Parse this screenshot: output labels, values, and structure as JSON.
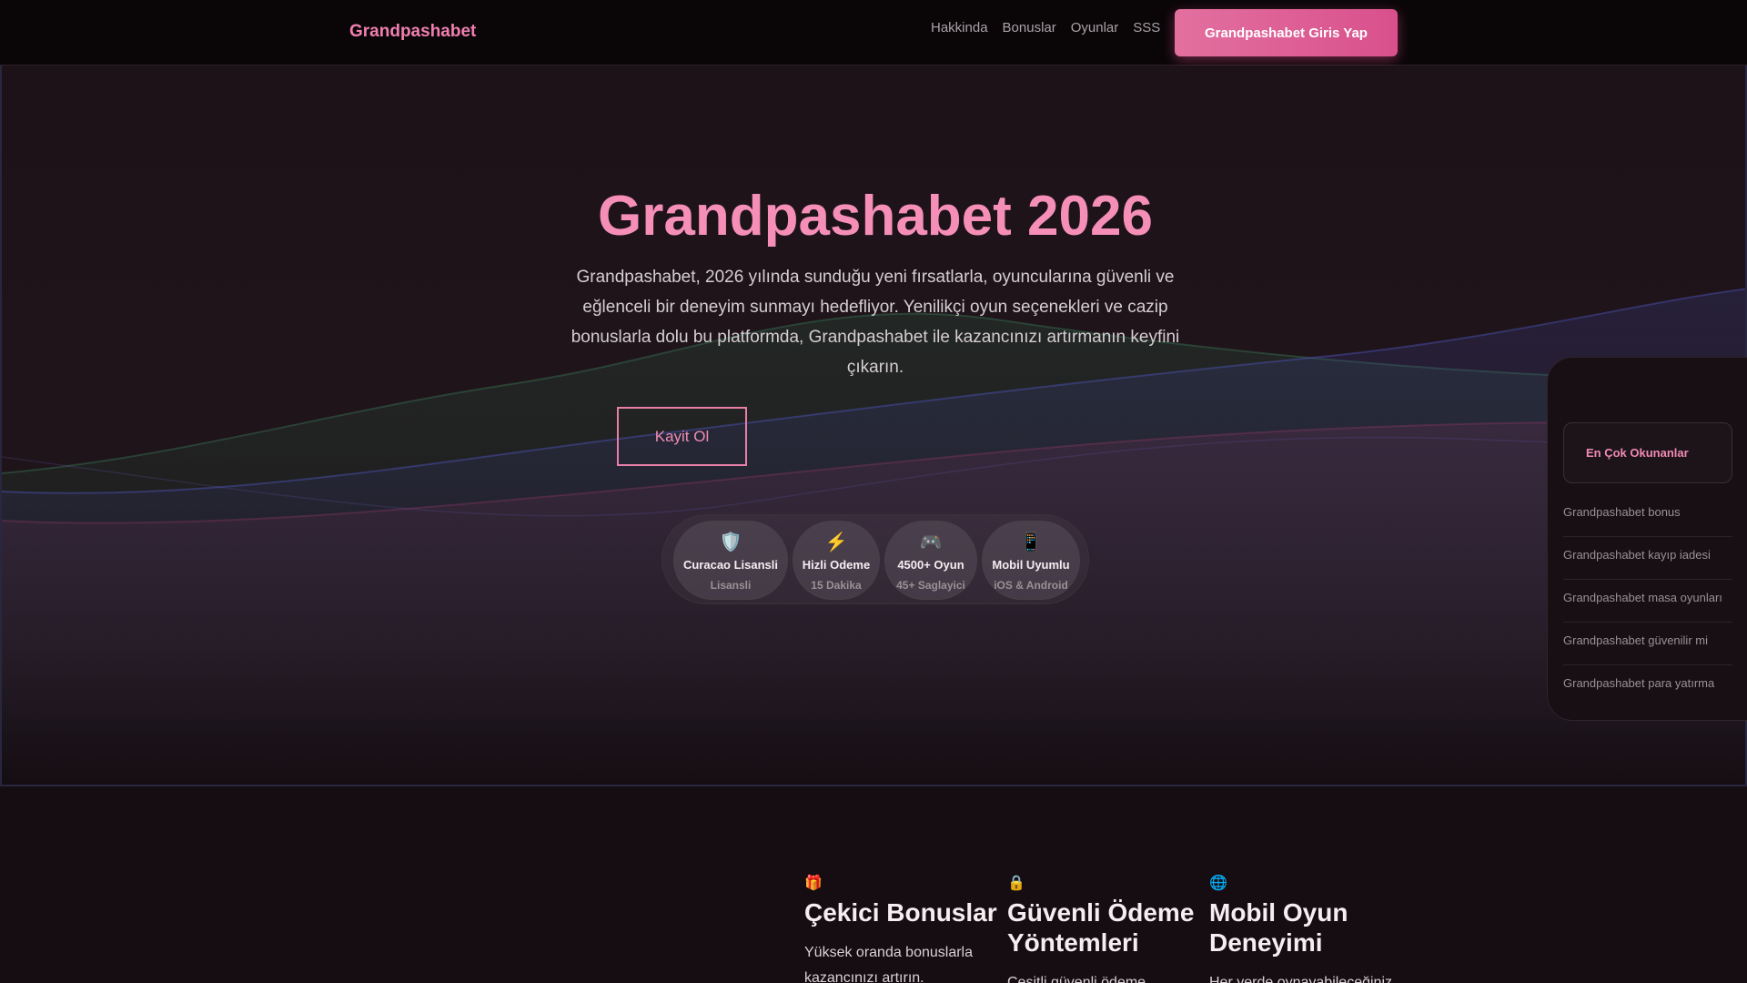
{
  "nav": {
    "brand": "Grandpashabet",
    "links": [
      "Hakkinda",
      "Bonuslar",
      "Oyunlar",
      "SSS"
    ],
    "login_label": "Grandpashabet Giris Yap"
  },
  "hero": {
    "title": "Grandpashabet 2026",
    "description": "Grandpashabet, 2026 yılında sunduğu yeni fırsatlarla, oyuncularına güvenli ve eğlenceli bir deneyim sunmayı hedefliyor. Yenilikçi oyun seçenekleri ve cazip bonuslarla dolu bu platformda, Grandpashabet ile kazancınızı artırmanın keyfini çıkarın.",
    "register_label": "Kayit Ol",
    "features": [
      {
        "icon": "🛡️",
        "icon_name": "shield-icon",
        "title": "Curacao Lisansli",
        "sub": "Lisansli"
      },
      {
        "icon": "⚡",
        "icon_name": "lightning-icon",
        "title": "Hizli Odeme",
        "sub": "15 Dakika"
      },
      {
        "icon": "🎮",
        "icon_name": "gamepad-icon",
        "title": "4500+ Oyun",
        "sub": "45+ Saglayici"
      },
      {
        "icon": "📱",
        "icon_name": "mobile-phone-icon",
        "title": "Mobil Uyumlu",
        "sub": "iOS & Android"
      }
    ]
  },
  "sidebar": {
    "heading": "En Çok Okunanlar",
    "items": [
      "Grandpashabet bonus",
      "Grandpashabet kayıp iadesi",
      "Grandpashabet masa oyunları",
      "Grandpashabet güvenilir mi",
      "Grandpashabet para yatırma"
    ]
  },
  "cards": [
    {
      "icon": "🎁",
      "icon_name": "gift-icon",
      "title": "Çekici Bonuslar",
      "text": "Yüksek oranda bonuslarla kazancınızı artırın."
    },
    {
      "icon": "🔒",
      "icon_name": "lock-icon",
      "title": "Güvenli Ödeme Yöntemleri",
      "text": "Çeşitli güvenli ödeme"
    },
    {
      "icon": "🌐",
      "icon_name": "globe-icon",
      "title": "Mobil Oyun Deneyimi",
      "text": "Her yerde oynayabileceğiniz"
    }
  ],
  "colors": {
    "accent": "#f58fb8",
    "button_gradient_start": "#e2709f",
    "button_gradient_end": "#d9508c",
    "background": "#120b0f"
  }
}
